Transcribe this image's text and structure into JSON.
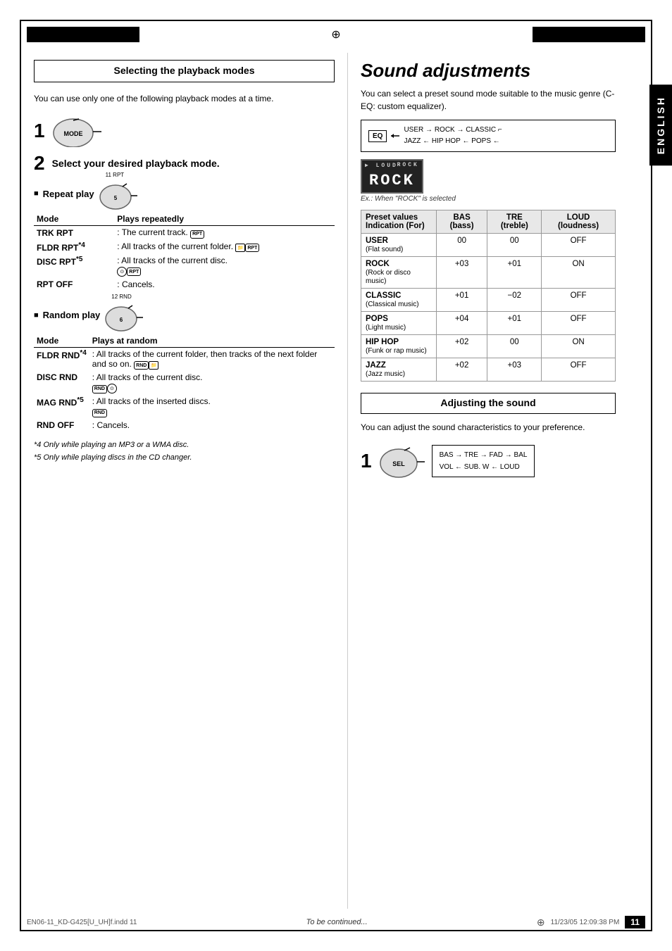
{
  "page": {
    "title": "Sound adjustments",
    "language_label": "ENGLISH",
    "page_number": "11",
    "footer_file": "EN06-11_KD-G425[U_UH]f.indd  11",
    "footer_date": "11/23/05  12:09:38 PM",
    "to_be_continued": "To be continued..."
  },
  "left": {
    "section_title": "Selecting the playback modes",
    "body_text": "You can use only one of the following playback modes at a time.",
    "step1_num": "1",
    "step2_num": "2",
    "step2_label": "Select your desired playback mode.",
    "repeat_play_label": "Repeat play",
    "repeat_dial_top": "11  RPT",
    "repeat_modes_header_col1": "Mode",
    "repeat_modes_header_col2": "Plays repeatedly",
    "repeat_modes": [
      {
        "mode": "TRK RPT",
        "desc": ": The current track."
      },
      {
        "mode": "FLDR RPT*4",
        "desc": ": All tracks of the current folder."
      },
      {
        "mode": "DISC RPT*5",
        "desc": ": All tracks of the current disc."
      },
      {
        "mode": "RPT OFF",
        "desc": ": Cancels."
      }
    ],
    "random_play_label": "Random play",
    "random_dial_top": "12  RND",
    "random_modes_header_col1": "Mode",
    "random_modes_header_col2": "Plays at random",
    "random_modes": [
      {
        "mode": "FLDR RND*4",
        "desc": ": All tracks of the current folder, then tracks of the next folder and so on."
      },
      {
        "mode": "DISC RND",
        "desc": ": All tracks of the current disc."
      },
      {
        "mode": "MAG RND*5",
        "desc": ": All tracks of the inserted discs."
      },
      {
        "mode": "RND OFF",
        "desc": ": Cancels."
      }
    ],
    "footnote4": "*4  Only while playing an MP3 or a WMA disc.",
    "footnote5": "*5  Only while playing discs in the CD changer."
  },
  "right": {
    "section_title": "Sound adjustments",
    "body_text": "You can select a preset sound mode suitable to the music genre (C-EQ: custom equalizer).",
    "eq_flow_top": "USER → ROCK → CLASSIC",
    "eq_flow_bottom": "JAZZ ← HIP HOP ← POPS",
    "eq_box_label": "EQ",
    "rock_display": "ROCK",
    "display_caption": "Ex.: When \"ROCK\" is selected",
    "preset_table": {
      "header_col1": "Preset values",
      "header_col1b": "Indication (For)",
      "header_col2": "BAS (bass)",
      "header_col3": "TRE (treble)",
      "header_col4": "LOUD (loudness)",
      "rows": [
        {
          "name": "USER",
          "sub": "(Flat sound)",
          "bas": "00",
          "tre": "00",
          "loud": "OFF"
        },
        {
          "name": "ROCK",
          "sub": "(Rock or disco music)",
          "bas": "+03",
          "tre": "+01",
          "loud": "ON"
        },
        {
          "name": "CLASSIC",
          "sub": "(Classical music)",
          "bas": "+01",
          "tre": "−02",
          "loud": "OFF"
        },
        {
          "name": "POPS",
          "sub": "(Light music)",
          "bas": "+04",
          "tre": "+01",
          "loud": "OFF"
        },
        {
          "name": "HIP HOP",
          "sub": "(Funk or rap music)",
          "bas": "+02",
          "tre": "00",
          "loud": "ON"
        },
        {
          "name": "JAZZ",
          "sub": "(Jazz music)",
          "bas": "+02",
          "tre": "+03",
          "loud": "OFF"
        }
      ]
    },
    "adj_section_title": "Adjusting the sound",
    "adj_body": "You can adjust the sound characteristics to your preference.",
    "adj_step1": "1",
    "adj_flow_top": "BAS → TRE → FAD → BAL",
    "adj_flow_bottom": "VOL ← SUB. W ← LOUD",
    "adj_sel_label": "SEL"
  }
}
